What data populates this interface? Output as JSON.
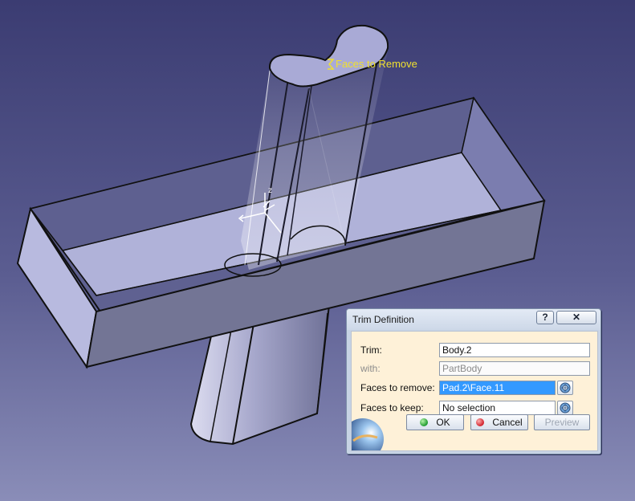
{
  "viewport": {
    "background_top": "#3b3c72",
    "background_bottom": "#8a8db8",
    "annotation_label": "Faces to Remove",
    "axis_label": "z"
  },
  "dialog": {
    "title": "Trim Definition",
    "help_label": "?",
    "close_label": "✕",
    "fields": {
      "trim": {
        "label": "Trim:",
        "value": "Body.2"
      },
      "with": {
        "label": "with:",
        "value": "PartBody"
      },
      "faces_to_remove": {
        "label": "Faces to remove:",
        "value": "Pad.2\\Face.11"
      },
      "faces_to_keep": {
        "label": "Faces to keep:",
        "value": "No selection"
      }
    },
    "buttons": {
      "ok": "OK",
      "cancel": "Cancel",
      "preview": "Preview"
    },
    "colors": {
      "ok_icon": "#1f9a2e",
      "cancel_icon": "#d0202a",
      "selection": "#3399ff"
    },
    "icons": {
      "pick": "selection-picker-icon",
      "corner": "globe-icon"
    }
  }
}
